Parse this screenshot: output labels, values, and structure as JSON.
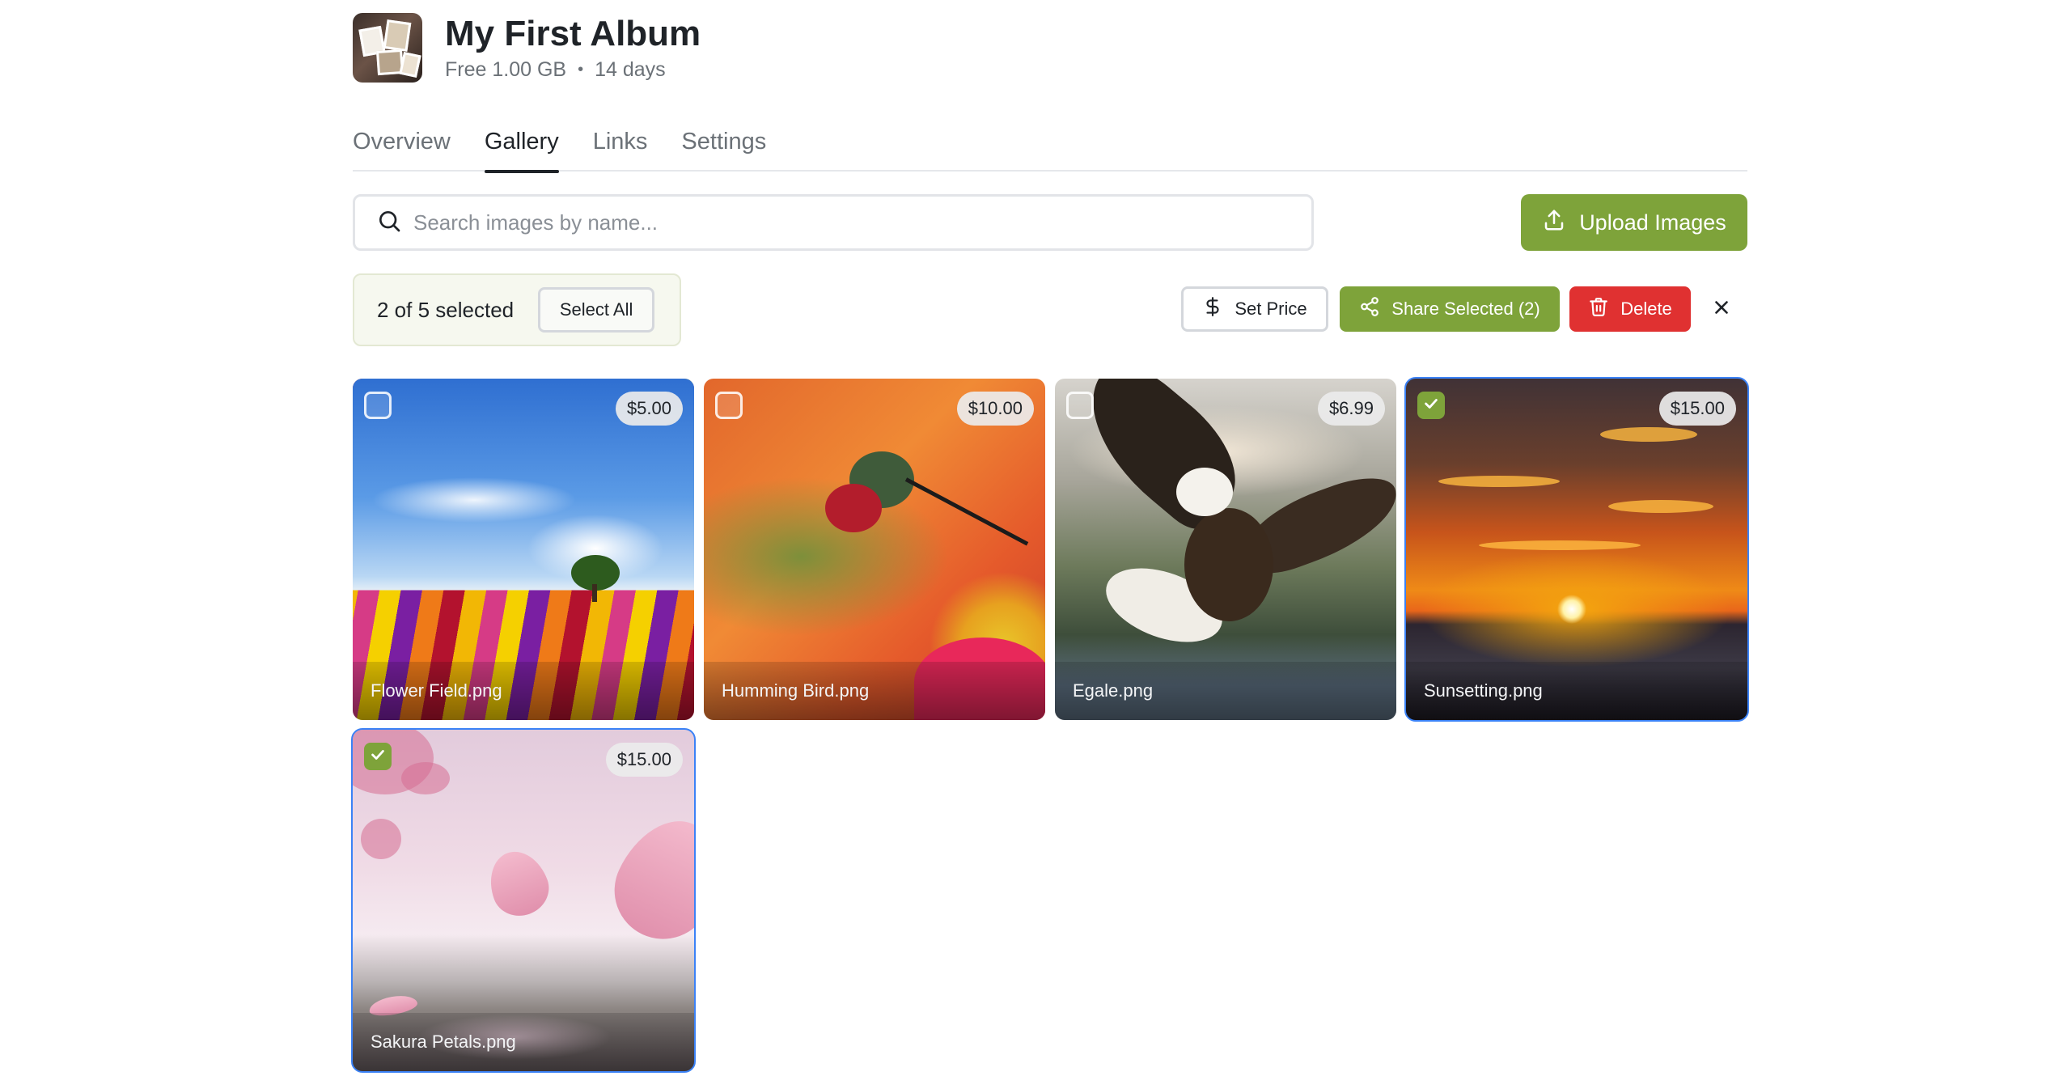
{
  "header": {
    "title": "My First Album",
    "plan": "Free 1.00 GB",
    "separator": "•",
    "duration": "14 days"
  },
  "tabs": [
    {
      "label": "Overview",
      "active": false
    },
    {
      "label": "Gallery",
      "active": true
    },
    {
      "label": "Links",
      "active": false
    },
    {
      "label": "Settings",
      "active": false
    }
  ],
  "search": {
    "placeholder": "Search images by name...",
    "value": ""
  },
  "upload": {
    "label": "Upload Images"
  },
  "selection": {
    "text": "2 of 5 selected",
    "select_all": "Select All",
    "set_price": "Set Price",
    "share": "Share Selected (2)",
    "delete": "Delete"
  },
  "gallery": [
    {
      "name": "Flower Field.png",
      "price": "$5.00",
      "selected": false
    },
    {
      "name": "Humming Bird.png",
      "price": "$10.00",
      "selected": false
    },
    {
      "name": "Egale.png",
      "price": "$6.99",
      "selected": false
    },
    {
      "name": "Sunsetting.png",
      "price": "$15.00",
      "selected": true
    },
    {
      "name": "Sakura Petals.png",
      "price": "$15.00",
      "selected": true
    }
  ],
  "colors": {
    "accent_green": "#7ea33a",
    "danger_red": "#e03131",
    "selection_blue": "#3b82f6"
  },
  "icons": [
    "search-icon",
    "upload-icon",
    "dollar-icon",
    "share-icon",
    "trash-icon",
    "close-icon",
    "check-icon"
  ]
}
